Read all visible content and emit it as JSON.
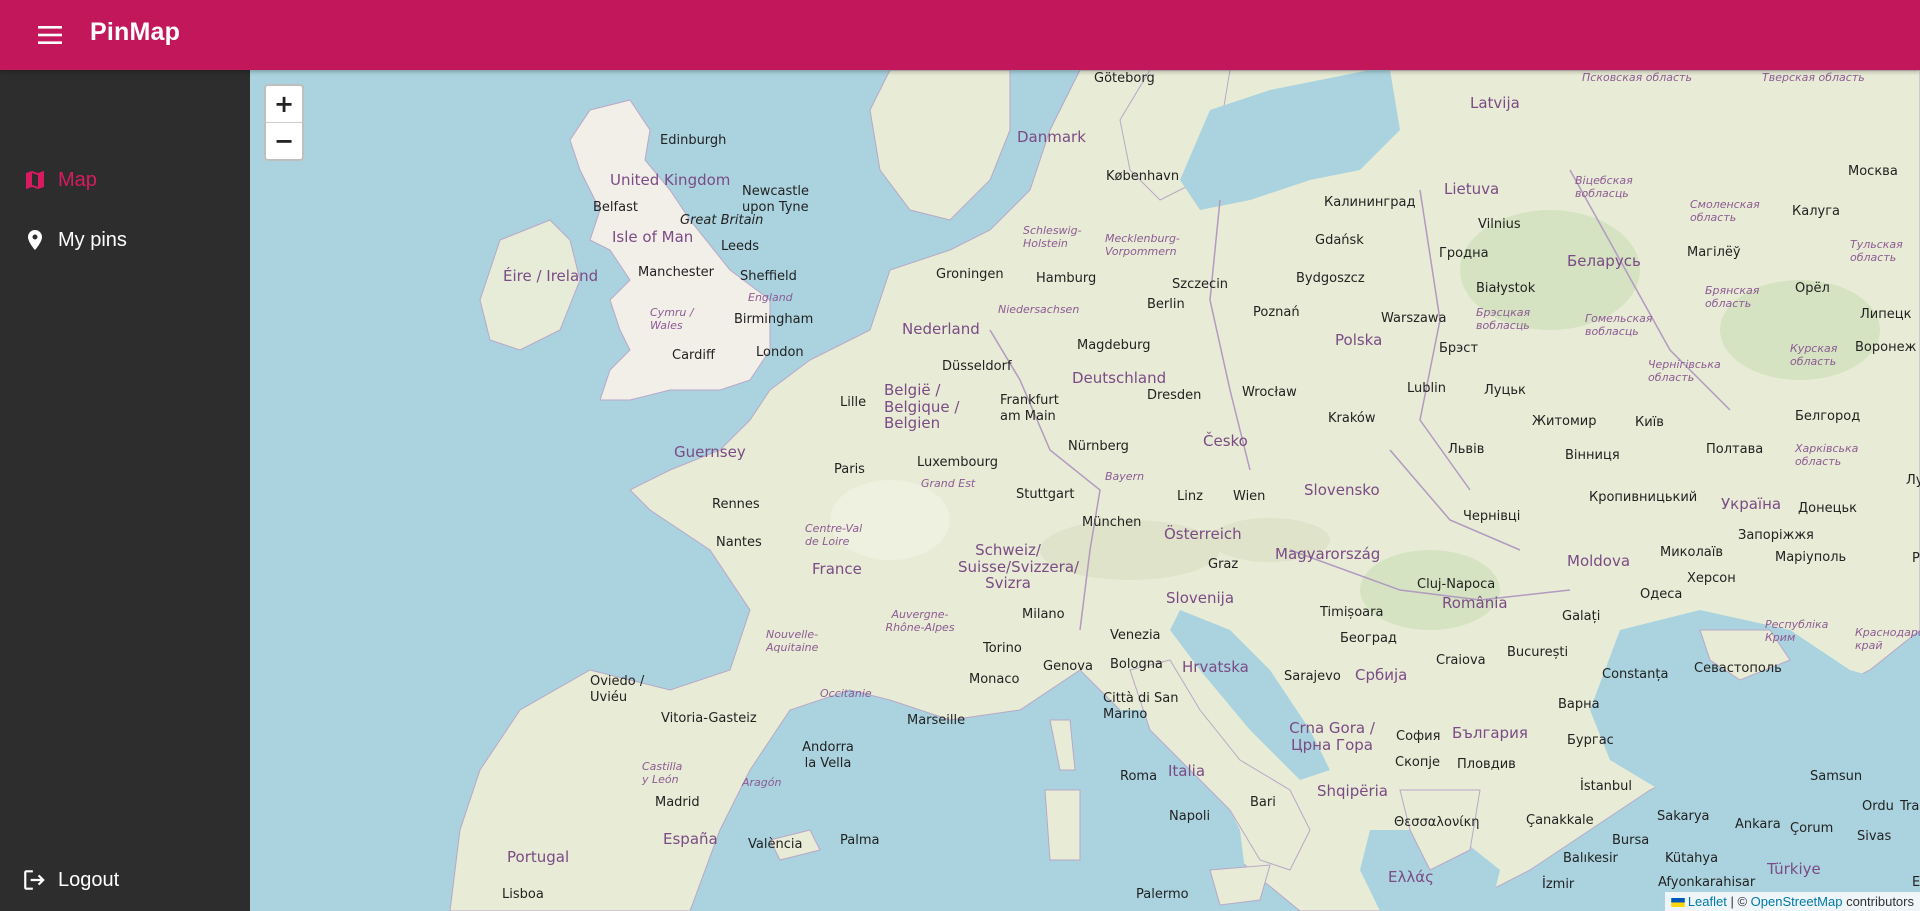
{
  "app": {
    "title": "PinMap",
    "menu_icon": "menu-icon",
    "accent_color": "#c2185b"
  },
  "sidebar": {
    "items": [
      {
        "label": "Map",
        "icon": "map-icon",
        "active": true
      },
      {
        "label": "My pins",
        "icon": "location-pin-icon",
        "active": false
      }
    ],
    "logout": {
      "label": "Logout",
      "icon": "logout-icon"
    }
  },
  "map": {
    "zoom_in": "+",
    "zoom_out": "−",
    "attribution": {
      "leaflet": "Leaflet",
      "separator": " | © ",
      "osm": "OpenStreetMap",
      "suffix": " contributors"
    },
    "labels": {
      "goteborg": "Göteborg",
      "latvija": "Latvija",
      "pskov": "Псковская область",
      "tver": "Тверская область",
      "danmark": "Danmark",
      "kobenhavn": "København",
      "edinburgh": "Edinburgh",
      "united_kingdom": "United Kingdom",
      "newcastle": "Newcastle upon Tyne",
      "belfast": "Belfast",
      "great_britain": "Great Britain",
      "isle_of_man": "Isle of Man",
      "leeds": "Leeds",
      "eire": "Éire / Ireland",
      "manchester": "Manchester",
      "sheffield": "Sheffield",
      "england": "England",
      "cymru": "Cymru / Wales",
      "birmingham": "Birmingham",
      "cardiff": "Cardiff",
      "london": "London",
      "lietuva": "Lietuva",
      "kaliningrad": "Калининград",
      "gdansk": "Gdańsk",
      "vilnius": "Vilnius",
      "hrodna": "Гродна",
      "belarus": "Беларусь",
      "mahilou": "Магілёў",
      "vitsebsk": "Віцебская вобласць",
      "smolensk": "Смоленская область",
      "moskva": "Москва",
      "kaluga": "Калуга",
      "tula": "Тульская область",
      "oryol": "Орёл",
      "lipetsk": "Липецк",
      "bryansk": "Брянская область",
      "homiel": "Гомельская вобласць",
      "kursk": "Курская область",
      "voronezh": "Воронеж",
      "schleswig": "Schleswig-Holstein",
      "mecklenburg": "Mecklenburg-Vorpommern",
      "groningen": "Groningen",
      "hamburg": "Hamburg",
      "szczecin": "Szczecin",
      "bydgoszcz": "Bydgoszcz",
      "berlin": "Berlin",
      "niedersachsen": "Niedersachsen",
      "nederland": "Nederland",
      "magdeburg": "Magdeburg",
      "poznan": "Poznań",
      "warszawa": "Warszawa",
      "polska": "Polska",
      "bialystok": "Białystok",
      "brest_region": "Брэсцкая вобласць",
      "brest": "Брэст",
      "dusseldorf": "Düsseldorf",
      "belgie": "België / Belgique / Belgien",
      "deutschland": "Deutschland",
      "lille": "Lille",
      "frankfurt": "Frankfurt am Main",
      "dresden": "Dresden",
      "wroclaw": "Wrocław",
      "lublin": "Lublin",
      "lutsk": "Луцьк",
      "chernihiv": "Чернігівська область",
      "zhytomyr": "Житомир",
      "kyiv": "Київ",
      "bilhorod": "Белгород",
      "krakow": "Kraków",
      "cesko": "Česko",
      "nurnberg": "Nürnberg",
      "guernsey": "Guernsey",
      "paris": "Paris",
      "luxembourg": "Luxembourg",
      "lviv": "Львів",
      "vinnytsia": "Вінниця",
      "poltava": "Полтава",
      "kharkiv": "Харківська область",
      "bayern": "Bayern",
      "grand_est": "Grand Est",
      "stuttgart": "Stuttgart",
      "linz": "Linz",
      "wien": "Wien",
      "slovensko": "Slovensko",
      "rennes": "Rennes",
      "kropyvnytskyi": "Кропивницький",
      "ukraina": "Україна",
      "donetsk": "Донецьк",
      "luhansk": "Луганськ",
      "chernivtsi": "Чернівці",
      "munchen": "München",
      "osterreich": "Österreich",
      "centre": "Centre-Val de Loire",
      "nantes": "Nantes",
      "zaporizhzhia": "Запоріжжя",
      "schweiz": "Schweiz/ Suisse/Svizzera/ Svizra",
      "magyarorszag": "Magyarország",
      "mykolaiv": "Миколаїв",
      "mariupol": "Маріуполь",
      "rostov": "Ростов",
      "france": "France",
      "graz": "Graz",
      "moldova": "Moldova",
      "kherson": "Херсон",
      "cluj": "Cluj-Napoca",
      "odesa": "Одеса",
      "slovenija": "Slovenija",
      "romania": "România",
      "timisoara": "Timișoara",
      "galati": "Galați",
      "auvergne": "Auvergne-Rhône-Alpes",
      "milano": "Milano",
      "nouvelle": "Nouvelle-Aquitaine",
      "venezia": "Venezia",
      "krym": "Республіка Крим",
      "krasnodar": "Краснодарский край",
      "beograd": "Београд",
      "torino": "Torino",
      "hrvatska": "Hrvatska",
      "craiova": "Craiova",
      "bucuresti": "București",
      "genova": "Genova",
      "bologna": "Bologna",
      "sarajevo": "Sarajevo",
      "srbija": "Србија",
      "constanta": "Constanța",
      "sevastopol": "Севастополь",
      "oviedo": "Oviedo / Uviéu",
      "monaco": "Monaco",
      "occitanie": "Occitanie",
      "san_marino": "Città di San Marino",
      "varna": "Варна",
      "vitoria": "Vitoria-Gasteiz",
      "marseille": "Marseille",
      "crna_gora": "Crna Gora / Црна Гора",
      "sofia": "София",
      "balgaria": "България",
      "burgas": "Бургас",
      "andorra": "Andorra la Vella",
      "castilla": "Castilla y León",
      "aragon": "Aragón",
      "roma": "Roma",
      "italia": "Italia",
      "skopje": "Скопје",
      "plovdiv": "Пловдив",
      "istanbul": "İstanbul",
      "samsun": "Samsun",
      "madrid": "Madrid",
      "shqiperia": "Shqipëria",
      "bari": "Bari",
      "sakarya": "Sakarya",
      "ordu": "Ordu",
      "trabzon": "Trabz",
      "thessaloniki": "Θεσσαλονίκη",
      "canakkale": "Çanakkale",
      "ankara": "Ankara",
      "corum": "Çorum",
      "espana": "España",
      "palma": "Palma",
      "valencia": "València",
      "napoli": "Napoli",
      "bursa": "Bursa",
      "sivas": "Sivas",
      "portugal": "Portugal",
      "balikesir": "Balıkesir",
      "kutahya": "Kütahya",
      "turkiye": "Türkiye",
      "ellas": "Ελλάς",
      "izmir": "İzmir",
      "afyon": "Afyonkarahisar",
      "erzincan": "Erzinc",
      "lisboa": "Lisboa",
      "palermo": "Palermo"
    }
  }
}
